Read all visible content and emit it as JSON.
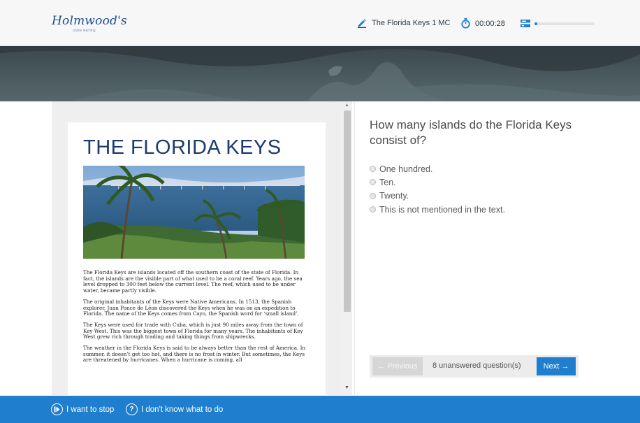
{
  "header": {
    "logo_text": "Holmwood's",
    "logo_subtext": "online learning",
    "test_name": "The Florida Keys 1 MC",
    "timer": "00:00:28",
    "progress_fraction": 0.05,
    "icons": [
      "pencil-icon",
      "stopwatch-icon",
      "progress-icon"
    ]
  },
  "document": {
    "title": "THE FLORIDA KEYS",
    "photo_alt": "Palm trees on the shore with a long bridge over the sea",
    "paragraphs": [
      "The Florida Keys are islands located off the southern coast of the state of Florida. In fact, the islands are the visible part of what used to be a coral reef. Years ago, the sea level dropped to 300 feet below the current level. The reef, which used to be under water, became partly visible.",
      "The original inhabitants of the Keys were Native Americans. In 1513, the Spanish explorer, Juan Ponce de Léon discovered the Keys when he was on an expedition to Florida. The name of the Keys comes from Cayo, the Spanish word for ‘small island’.",
      "The Keys were used for trade with Cuba, which is just 90 miles away from the town of Key West. This was the biggest town of Florida for many years. The inhabitants of Key West grew rich through trading and taking things from shipwrecks.",
      "The weather in the Florida Keys is said to be always better than the rest of America. In summer, it doesn’t get too hot, and there is no frost in winter. But sometimes, the Keys are threatened by hurricanes. When a hurricane is coming, all"
    ]
  },
  "question": {
    "text": "How many islands do the Florida Keys consist of?",
    "options": [
      "One hundred.",
      "Ten.",
      "Twenty.",
      "This is not mentioned in the text."
    ]
  },
  "navigation": {
    "previous_label": "← Previous",
    "unanswered_text": "8 unanswered question(s)",
    "next_label": "Next →"
  },
  "footer": {
    "stop_label": "I want to stop",
    "help_label": "I don't know what to do"
  },
  "colors": {
    "accent": "#1f7fce",
    "title_navy": "#1d3b6e"
  }
}
